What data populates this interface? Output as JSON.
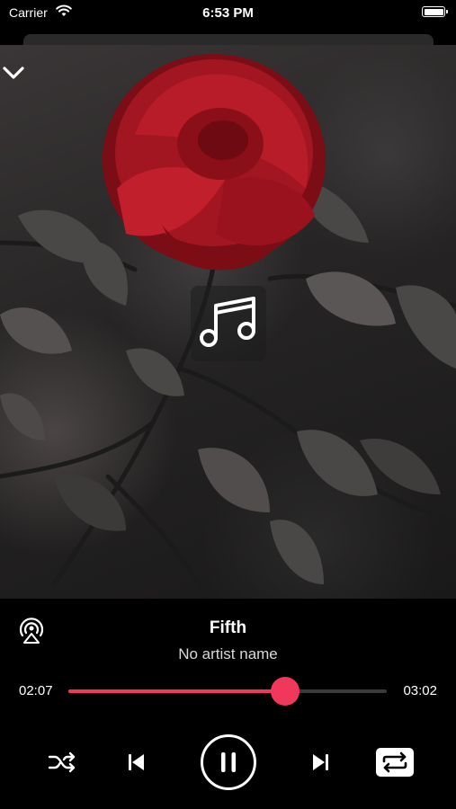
{
  "status_bar": {
    "carrier": "Carrier",
    "time": "6:53 PM",
    "icons": [
      "wifi-icon",
      "battery-icon"
    ]
  },
  "player": {
    "collapse_icon": "chevron-down-icon",
    "artwork_placeholder_icon": "music-note-icon",
    "airplay_icon": "airplay-icon",
    "title": "Fifth",
    "artist": "No artist name",
    "elapsed": "02:07",
    "duration": "03:02",
    "progress": 0.68,
    "accent_color": "#f0385a",
    "controls": {
      "shuffle_icon": "shuffle-icon",
      "previous_icon": "skip-back-icon",
      "pause_icon": "pause-icon",
      "next_icon": "skip-forward-icon",
      "repeat_icon": "repeat-icon",
      "repeat_active": true
    }
  }
}
